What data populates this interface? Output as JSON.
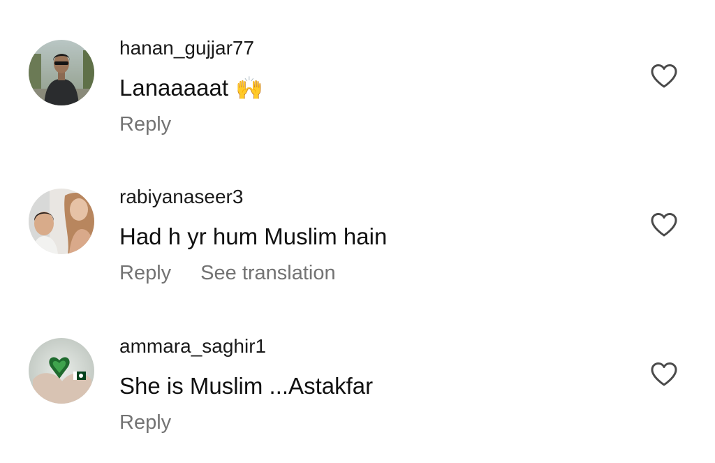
{
  "comments": [
    {
      "username": "hanan_gujjar77",
      "text": "Lanaaaaat",
      "emoji": "🙌",
      "reply_label": "Reply"
    },
    {
      "username": "rabiyanaseer3",
      "text": "Had h yr hum Muslim hain",
      "reply_label": "Reply",
      "translation_label": "See translation"
    },
    {
      "username": "ammara_saghir1",
      "text": "She is Muslim ...Astakfar",
      "reply_label": "Reply"
    }
  ],
  "icons": {
    "like": "heart-outline-icon",
    "emoji": "raising-hands-emoji"
  },
  "colors": {
    "username": "#1a1a1a",
    "text": "#111111",
    "secondary": "#737373",
    "heart_stroke": "#4a4a4a",
    "background": "#ffffff"
  }
}
